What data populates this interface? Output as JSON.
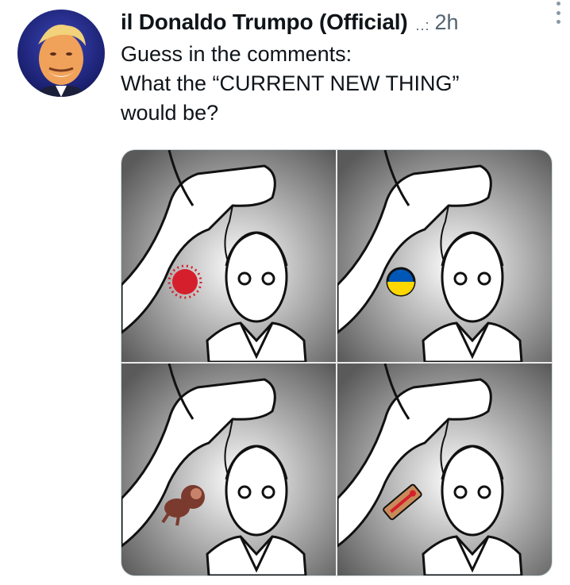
{
  "tweet": {
    "display_name": "il Donaldo Trumpo (Official)",
    "verified_glyph": "..:",
    "time": "2h",
    "text_lines": [
      "Guess in the comments:",
      "What the “CURRENT NEW THING”",
      "would be?"
    ]
  },
  "icons": {
    "avatar": "profile-photo",
    "more": "more-vertical-icon",
    "panel_1_object": "virus-icon",
    "panel_2_object": "ukraine-flag-badge-icon",
    "panel_3_object": "monkey-icon",
    "panel_4_object": "thermometer-icon"
  },
  "colors": {
    "text": "#0f1419",
    "secondary": "#536471",
    "virus": "#d61f2c",
    "flag_blue": "#0057b7",
    "flag_yellow": "#ffd700",
    "monkey": "#7a3b2e",
    "thermometer": "#c98a5a"
  }
}
